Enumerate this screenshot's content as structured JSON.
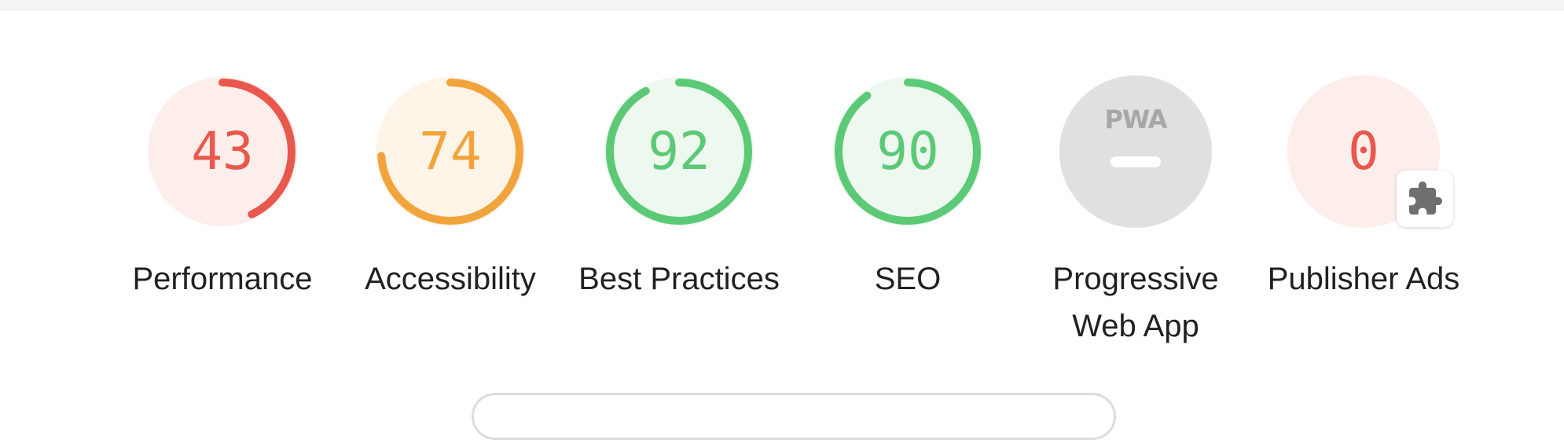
{
  "categories": [
    {
      "id": "performance",
      "score": "43",
      "fraction": 0.43,
      "label": "Performance",
      "color": "#e8584c",
      "bg": "#fdeeec"
    },
    {
      "id": "accessibility",
      "score": "74",
      "fraction": 0.74,
      "label": "Accessibility",
      "color": "#f2a43c",
      "bg": "#fef4e8"
    },
    {
      "id": "best-practices",
      "score": "92",
      "fraction": 0.92,
      "label": "Best Practices",
      "color": "#5cc976",
      "bg": "#edf9ef"
    },
    {
      "id": "seo",
      "score": "90",
      "fraction": 0.9,
      "label": "SEO",
      "color": "#5cc976",
      "bg": "#edf9ef"
    }
  ],
  "pwa": {
    "badge_text": "PWA",
    "label": "Progressive Web App",
    "bg": "#e0e0e0"
  },
  "publisher_ads": {
    "score": "0",
    "label": "Publisher Ads",
    "color": "#e8584c",
    "bg": "#fdeeec",
    "badge_icon": "puzzle-piece-icon"
  }
}
